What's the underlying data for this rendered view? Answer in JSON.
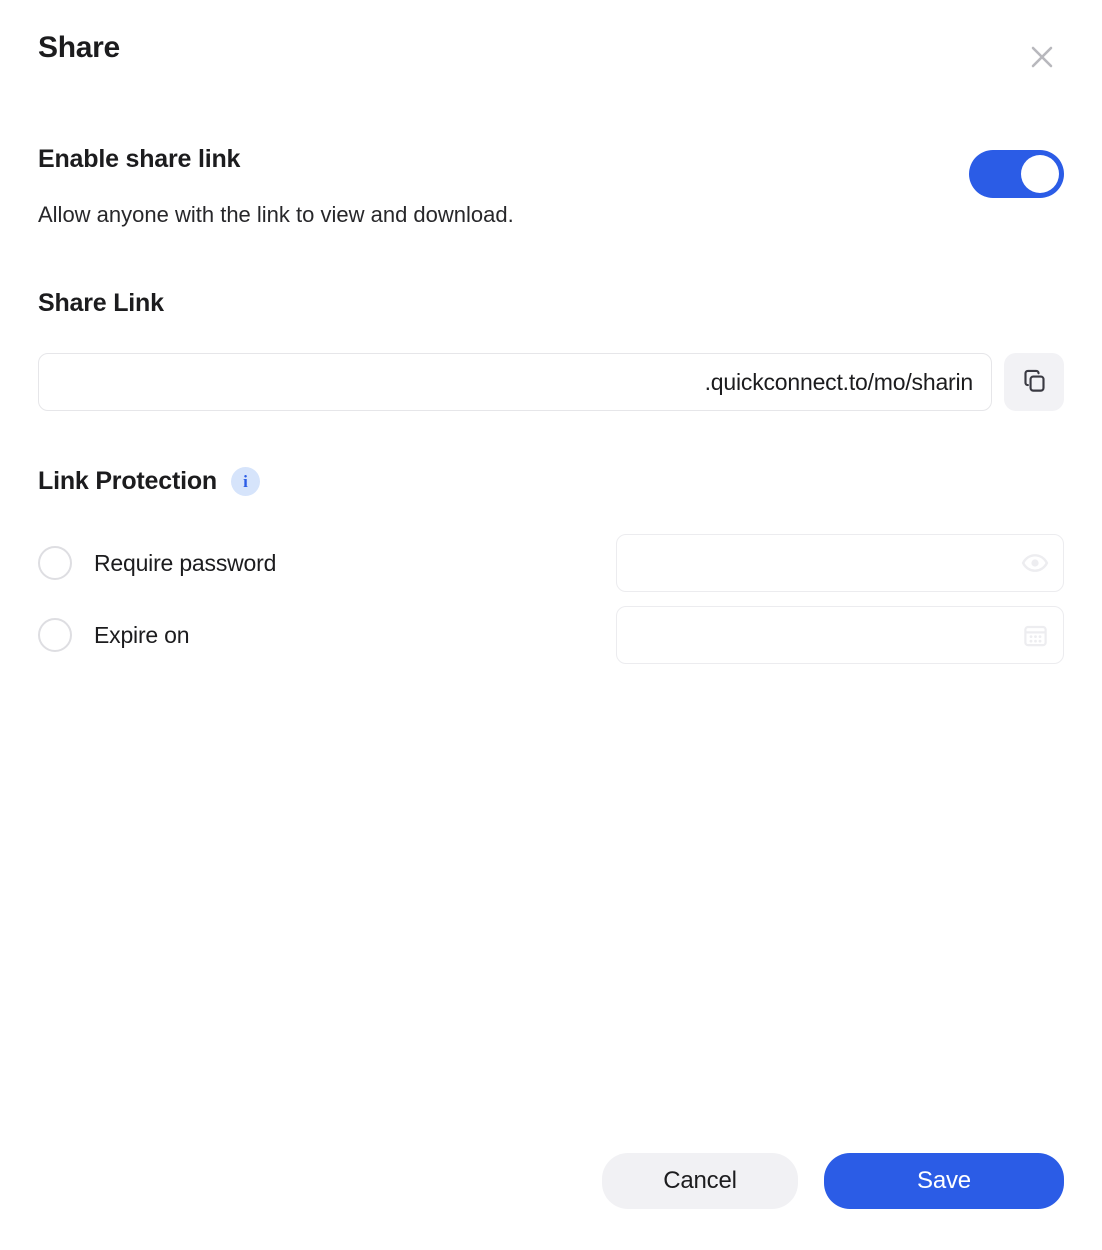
{
  "dialog": {
    "title": "Share",
    "close_icon": "close-icon"
  },
  "enable_share": {
    "heading": "Enable share link",
    "description": "Allow anyone with the link to view and download.",
    "toggle_state": "on",
    "toggle_color": "#2B5CE6"
  },
  "share_link": {
    "label": "Share Link",
    "value": ".quickconnect.to/mo/sharin",
    "placeholder": "",
    "copy_icon": "copy-icon"
  },
  "link_protection": {
    "heading": "Link Protection",
    "info_icon": "info-icon",
    "info_glyph": "i",
    "options": [
      {
        "label": "Require password",
        "checked": false,
        "field_value": "",
        "field_placeholder": "",
        "field_icon": "eye-icon"
      },
      {
        "label": "Expire on",
        "checked": false,
        "field_value": "",
        "field_placeholder": "",
        "field_icon": "calendar-icon"
      }
    ]
  },
  "footer": {
    "cancel_label": "Cancel",
    "save_label": "Save",
    "save_color": "#2B5CE6",
    "cancel_color": "#F1F1F4"
  }
}
